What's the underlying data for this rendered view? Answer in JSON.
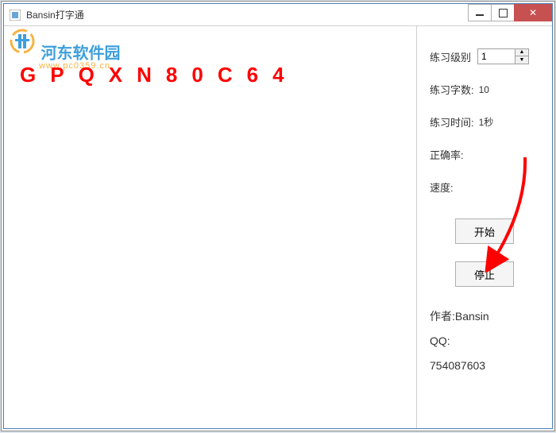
{
  "window": {
    "title": "Bansin打字通"
  },
  "watermark": {
    "text": "河东软件园",
    "url": "www.pc0359.cn"
  },
  "practice": {
    "display_text": "GPQXN80C64"
  },
  "sidebar": {
    "level_label": "练习级别",
    "level_value": "1",
    "count_label": "练习字数:",
    "count_value": "10",
    "time_label": "练习时间:",
    "time_value": "1秒",
    "accuracy_label": "正确率:",
    "accuracy_value": "",
    "speed_label": "速度:",
    "speed_value": "",
    "start_label": "开始",
    "stop_label": "停止"
  },
  "author": {
    "author_label": "作者:",
    "author_name": "Bansin",
    "qq_label": "QQ:",
    "qq_number": "754087603"
  }
}
